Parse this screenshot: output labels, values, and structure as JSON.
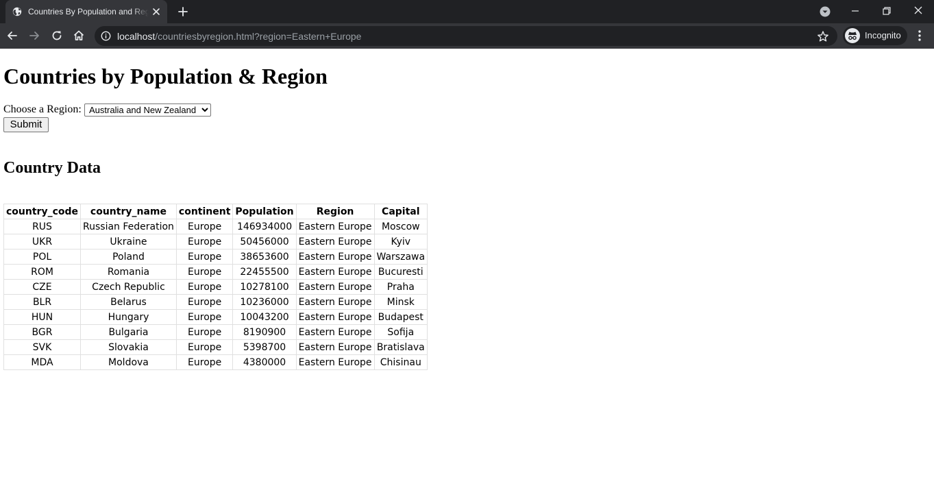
{
  "browser": {
    "tab_title": "Countries By Population and Region",
    "url_host": "localhost",
    "url_path": "/countriesbyregion.html?region=Eastern+Europe",
    "profile_label": "Incognito"
  },
  "page": {
    "title": "Countries by Population & Region",
    "region_label": "Choose a Region:",
    "region_selected": "Australia and New Zealand",
    "submit_label": "Submit",
    "section_title": "Country Data"
  },
  "table": {
    "columns": [
      "country_code",
      "country_name",
      "continent",
      "Population",
      "Region",
      "Capital"
    ],
    "rows": [
      [
        "RUS",
        "Russian Federation",
        "Europe",
        "146934000",
        "Eastern Europe",
        "Moscow"
      ],
      [
        "UKR",
        "Ukraine",
        "Europe",
        "50456000",
        "Eastern Europe",
        "Kyiv"
      ],
      [
        "POL",
        "Poland",
        "Europe",
        "38653600",
        "Eastern Europe",
        "Warszawa"
      ],
      [
        "ROM",
        "Romania",
        "Europe",
        "22455500",
        "Eastern Europe",
        "Bucuresti"
      ],
      [
        "CZE",
        "Czech Republic",
        "Europe",
        "10278100",
        "Eastern Europe",
        "Praha"
      ],
      [
        "BLR",
        "Belarus",
        "Europe",
        "10236000",
        "Eastern Europe",
        "Minsk"
      ],
      [
        "HUN",
        "Hungary",
        "Europe",
        "10043200",
        "Eastern Europe",
        "Budapest"
      ],
      [
        "BGR",
        "Bulgaria",
        "Europe",
        "8190900",
        "Eastern Europe",
        "Sofija"
      ],
      [
        "SVK",
        "Slovakia",
        "Europe",
        "5398700",
        "Eastern Europe",
        "Bratislava"
      ],
      [
        "MDA",
        "Moldova",
        "Europe",
        "4380000",
        "Eastern Europe",
        "Chisinau"
      ]
    ]
  },
  "icons": {
    "tab_favicon": "globe-icon",
    "tab_close": "close-icon",
    "new_tab": "plus-icon",
    "tab_search": "chevron-down-circle-icon",
    "back": "arrow-left-icon",
    "forward": "arrow-right-icon",
    "reload": "reload-icon",
    "home": "home-icon",
    "site_info": "info-icon",
    "bookmark": "star-icon",
    "incognito": "incognito-icon",
    "menu": "kebab-menu-icon"
  },
  "colors": {
    "chrome_dark": "#202124",
    "chrome_tab": "#35363a",
    "chrome_text": "#e8eaed",
    "url_muted": "#9aa0a6",
    "table_border": "#e0e0e0"
  }
}
